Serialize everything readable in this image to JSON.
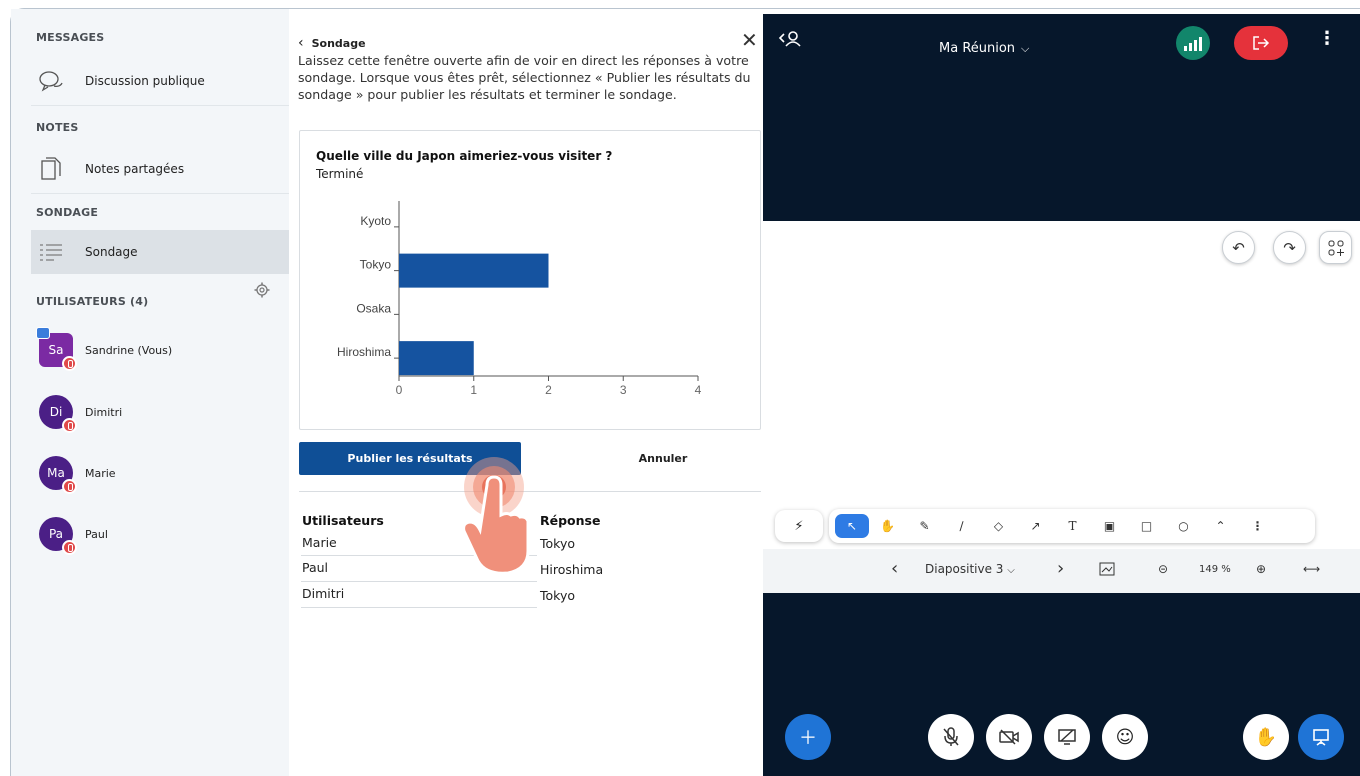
{
  "sidebar": {
    "messages_head": "MESSAGES",
    "public_chat": "Discussion publique",
    "notes_head": "NOTES",
    "shared_notes": "Notes partagées",
    "poll_head": "SONDAGE",
    "poll_item": "Sondage",
    "users_head": "UTILISATEURS (4)",
    "users": [
      {
        "initials": "Sa",
        "name": "Sandrine (Vous)",
        "color": "#7b2aa3"
      },
      {
        "initials": "Di",
        "name": "Dimitri",
        "color": "#5a2a8f"
      },
      {
        "initials": "Ma",
        "name": "Marie",
        "color": "#5a2a8f"
      },
      {
        "initials": "Pa",
        "name": "Paul",
        "color": "#5a2a8f"
      }
    ]
  },
  "poll": {
    "back_label": "Sondage",
    "description": "Laissez cette fenêtre ouverte afin de voir en direct les réponses à votre sondage. Lorsque vous êtes prêt, sélectionnez « Publier les résultats du sondage » pour publier les résultats et terminer le sondage.",
    "question": "Quelle ville du Japon aimeriez-vous visiter ?",
    "status": "Terminé",
    "publish_label": "Publier les résultats",
    "cancel_label": "Annuler",
    "table": {
      "col_users": "Utilisateurs",
      "col_answer": "Réponse",
      "rows": [
        {
          "user": "Marie",
          "answer": "Tokyo"
        },
        {
          "user": "Paul",
          "answer": "Hiroshima"
        },
        {
          "user": "Dimitri",
          "answer": "Tokyo"
        }
      ]
    }
  },
  "chart_data": {
    "type": "bar",
    "orientation": "horizontal",
    "categories": [
      "Kyoto",
      "Tokyo",
      "Osaka",
      "Hiroshima"
    ],
    "values": [
      0,
      2,
      0,
      1
    ],
    "xlim": [
      0,
      4
    ],
    "xticks": [
      "0",
      "1",
      "2",
      "3",
      "4"
    ],
    "bar_color": "#1553a0",
    "title": "",
    "xlabel": "",
    "ylabel": ""
  },
  "meeting": {
    "title": "Ma Réunion",
    "slide_label": "Diapositive 3",
    "zoom": "149 %",
    "accent_connection": "#12866b",
    "accent_leave": "#e5323b"
  }
}
